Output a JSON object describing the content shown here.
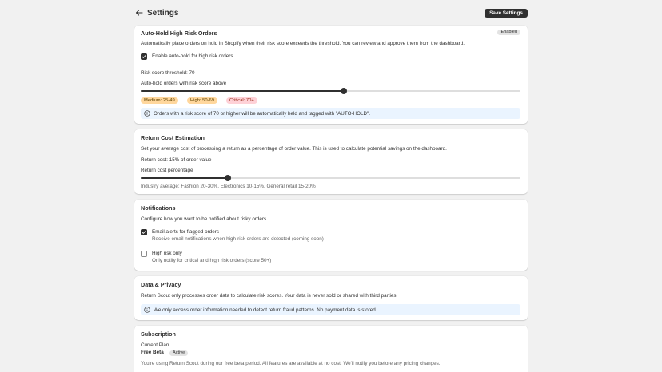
{
  "header": {
    "title": "Settings",
    "save_label": "Save Settings"
  },
  "auto_hold": {
    "title": "Auto-Hold High Risk Orders",
    "status_badge": "Enabled",
    "description": "Automatically place orders on hold in Shopify when their risk score exceeds the threshold. You can review and approve them from the dashboard.",
    "checkbox_label": "Enable auto-hold for high risk orders",
    "checkbox_checked": true,
    "threshold_text": "Risk score threshold: 70",
    "slider_label": "Auto-hold orders with risk score above",
    "slider_value": 70,
    "levels": [
      {
        "label": "Medium: 25-49",
        "bg": "#ffd79d",
        "fg": "#5e4200"
      },
      {
        "label": "High: 50-69",
        "bg": "#ffd79d",
        "fg": "#5e4200"
      },
      {
        "label": "Critical: 70+",
        "bg": "#fed1d7",
        "fg": "#8e1f0b"
      }
    ],
    "info": "Orders with a risk score of 70 or higher will be automatically held and tagged with \"AUTO-HOLD\"."
  },
  "return_cost": {
    "title": "Return Cost Estimation",
    "description": "Set your average cost of processing a return as a percentage of order value. This is used to calculate potential savings on the dashboard.",
    "value_text": "Return cost: 15% of order value",
    "slider_label": "Return cost percentage",
    "slider_fraction": 0.23,
    "industry_note": "Industry average: Fashion 20-30%, Electronics 10-15%, General retail 15-20%"
  },
  "notifications": {
    "title": "Notifications",
    "description": "Configure how you want to be notified about risky orders.",
    "email_label": "Email alerts for flagged orders",
    "email_desc": "Receive email notifications when high-risk orders are detected (coming soon)",
    "email_checked": true,
    "high_label": "High risk only",
    "high_desc": "Only notify for critical and high risk orders (score 50+)",
    "high_checked": false
  },
  "privacy": {
    "title": "Data & Privacy",
    "description": "Return Scout only processes order data to calculate risk scores. Your data is never sold or shared with third parties.",
    "info": "We only access order information needed to detect return fraud patterns. No payment data is stored."
  },
  "subscription": {
    "title": "Subscription",
    "current_plan_label": "Current Plan",
    "plan_name": "Free Beta",
    "plan_status": "Active",
    "note": "You're using Return Scout during our free beta period. All features are available at no cost. We'll notify you before any pricing changes."
  },
  "colors": {
    "accent": "#303030",
    "info_bg": "#eaf4ff",
    "page_bg": "#f1f1f1"
  }
}
